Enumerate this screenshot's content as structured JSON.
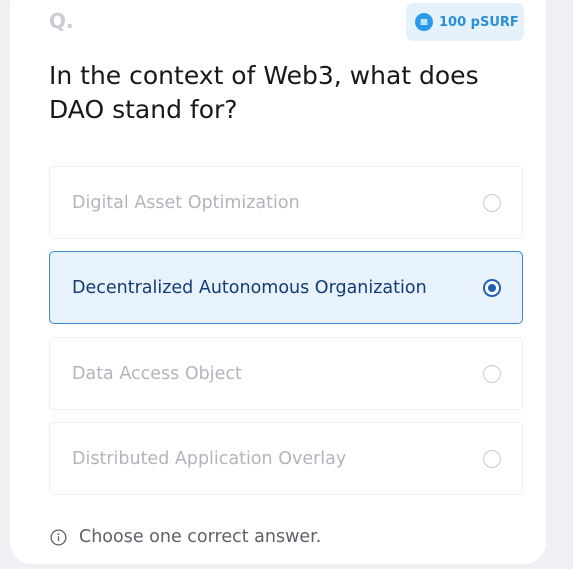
{
  "header": {
    "q_label": "Q.",
    "reward": "100 pSURF",
    "reward_icon": "coin-icon"
  },
  "question": "In the context of Web3, what does DAO stand for?",
  "options": [
    {
      "label": "Digital Asset Optimization",
      "selected": false
    },
    {
      "label": "Decentralized Autonomous Organization",
      "selected": true
    },
    {
      "label": "Data Access Object",
      "selected": false
    },
    {
      "label": "Distributed Application Overlay",
      "selected": false
    }
  ],
  "hint": "Choose one correct answer.",
  "colors": {
    "accent": "#1f5fb5",
    "selected_bg": "#e7f2fd",
    "badge_bg": "#e6f2fb",
    "badge_text": "#2a8fd8"
  }
}
